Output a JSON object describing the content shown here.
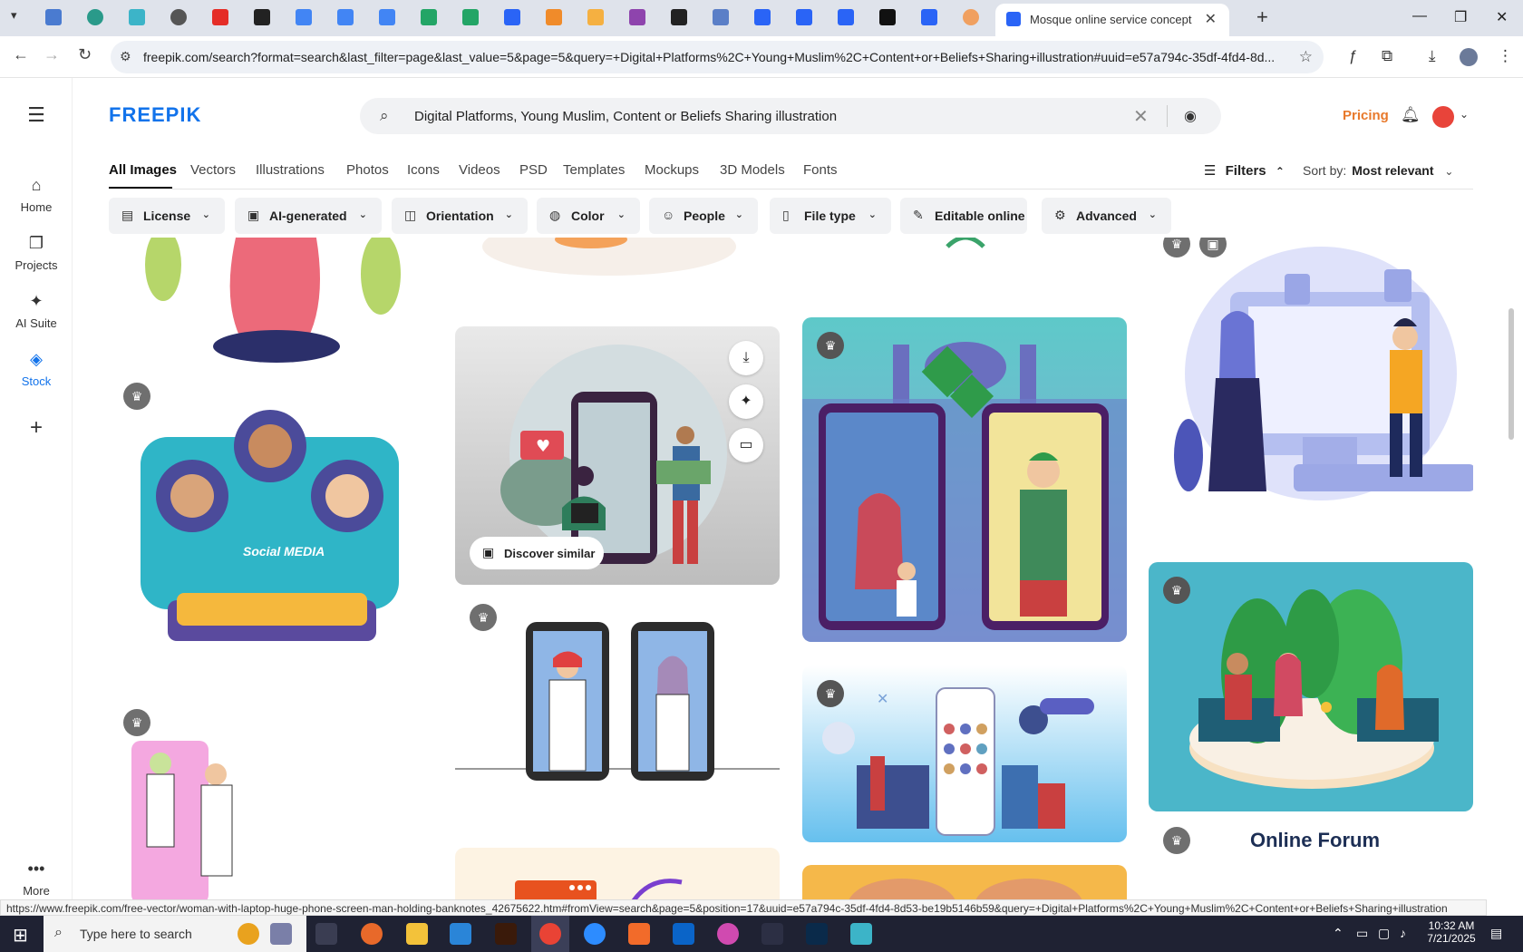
{
  "browser": {
    "active_tab_title": "Mosque online service concept",
    "url": "freepik.com/search?format=search&last_filter=page&last_value=5&page=5&query=+Digital+Platforms%2C+Young+Muslim%2C+Content+or+Beliefs+Sharing+illustration#uuid=e57a794c-35df-4fd4-8d...",
    "status_url": "https://www.freepik.com/free-vector/woman-with-laptop-huge-phone-screen-man-holding-banknotes_42675622.htm#fromView=search&page=5&position=17&uuid=e57a794c-35df-4fd4-8d53-be19b5146b59&query=+Digital+Platforms%2C+Young+Muslim%2C+Content+or+Beliefs+Sharing+illustration"
  },
  "sidebar": {
    "items": [
      {
        "label": "Home",
        "icon": "home-icon"
      },
      {
        "label": "Projects",
        "icon": "projects-icon"
      },
      {
        "label": "AI Suite",
        "icon": "sparkle-icon"
      },
      {
        "label": "Stock",
        "icon": "stock-icon"
      }
    ],
    "more_label": "More"
  },
  "header": {
    "logo": "FREEPIK",
    "search_query": "Digital Platforms, Young Muslim, Content or Beliefs Sharing illustration",
    "pricing_label": "Pricing"
  },
  "type_tabs": [
    "All Images",
    "Vectors",
    "Illustrations",
    "Photos",
    "Icons",
    "Videos",
    "PSD",
    "Templates",
    "Mockups",
    "3D Models",
    "Fonts"
  ],
  "toolbar": {
    "filters_label": "Filters",
    "sort_label": "Sort by:",
    "sort_value": "Most relevant"
  },
  "filter_chips": [
    "License",
    "AI-generated",
    "Orientation",
    "Color",
    "People",
    "File type",
    "Editable online",
    "Advanced"
  ],
  "grid": {
    "discover_label": "Discover similar",
    "social_media_text": "Social MEDIA",
    "forum_title": "Online Forum"
  },
  "taskbar": {
    "search_placeholder": "Type here to search",
    "time": "10:32 AM",
    "date": "7/21/2025"
  },
  "colors": {
    "brand": "#1273eb",
    "pricing": "#e8792b",
    "premium_badge": "#6f6f6f"
  }
}
